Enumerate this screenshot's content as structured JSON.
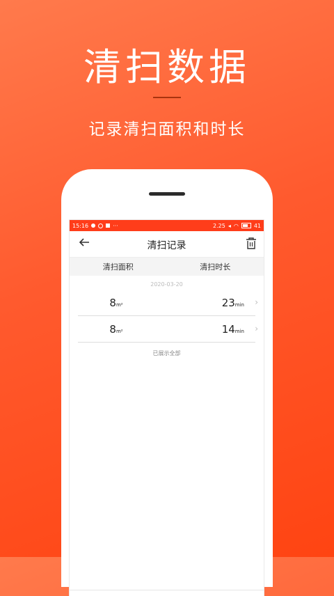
{
  "hero": {
    "title": "清扫数据",
    "subtitle": "记录清扫面积和时长"
  },
  "status_bar": {
    "time": "15:16",
    "speed": "2.25",
    "battery": "41"
  },
  "app_bar": {
    "title": "清扫记录"
  },
  "columns": {
    "area": "清扫面积",
    "duration": "清扫时长"
  },
  "date_label": "2020-03-20",
  "records": [
    {
      "area_value": "8",
      "area_unit": "m²",
      "duration_value": "23",
      "duration_unit": "min"
    },
    {
      "area_value": "8",
      "area_unit": "m²",
      "duration_value": "14",
      "duration_unit": "min"
    }
  ],
  "footer_note": "已展示全部",
  "colors": {
    "accent": "#ff3d1a",
    "gradient_start": "#ff7a4c",
    "gradient_end": "#ff4412"
  },
  "icons": [
    "back-arrow-icon",
    "trash-icon",
    "chevron-right-icon",
    "wifi-icon",
    "battery-icon"
  ]
}
